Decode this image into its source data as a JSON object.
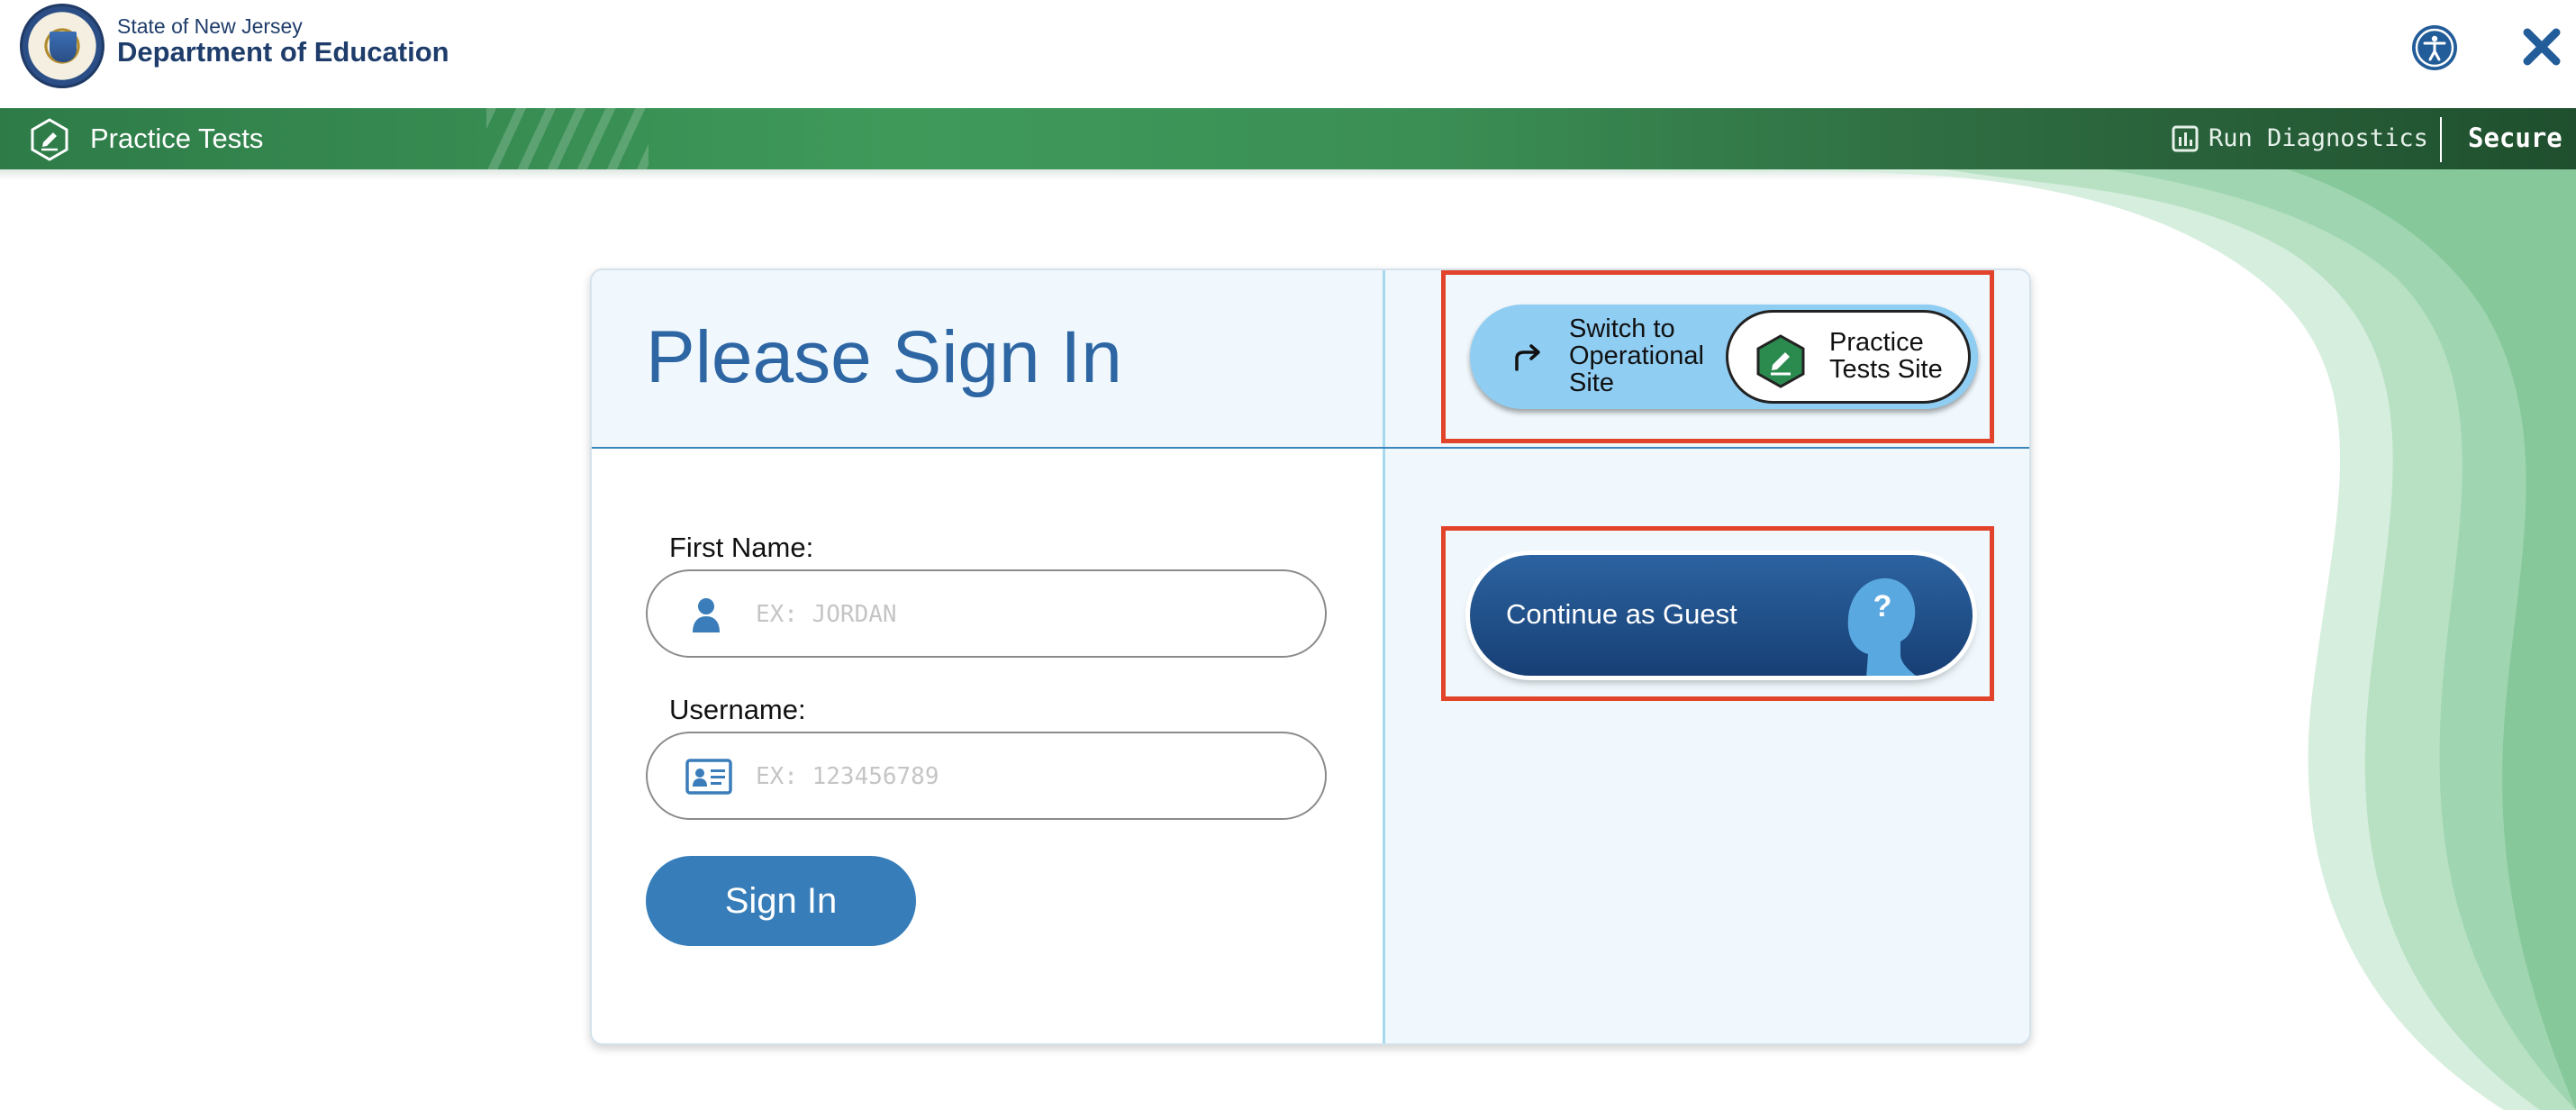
{
  "header": {
    "agency_sub": "State of New Jersey",
    "agency_main": "Department of Education",
    "icons": {
      "seal": "nj-state-seal-icon",
      "accessibility": "accessibility-icon",
      "close": "close-icon"
    }
  },
  "nav": {
    "title": "Practice Tests",
    "diagnostics_label": "Run Diagnostics",
    "secure_label": "Secure v",
    "icons": {
      "logo": "pencil-hexagon-icon",
      "diagnostics": "bar-chart-icon"
    }
  },
  "signin": {
    "title": "Please Sign In",
    "first_name_label": "First Name:",
    "first_name_placeholder": "EX: JORDAN",
    "first_name_value": "",
    "username_label": "Username:",
    "username_placeholder": "EX: 123456789",
    "username_value": "",
    "button_label": "Sign In",
    "icons": {
      "first_name": "person-icon",
      "username": "id-card-icon"
    }
  },
  "site_switch": {
    "switch_label": "Switch to Operational Site",
    "current_label": "Practice Tests Site",
    "icons": {
      "switch": "redirect-arrow-icon",
      "current": "pencil-hexagon-icon"
    }
  },
  "guest": {
    "label": "Continue as Guest",
    "icon": "guest-head-question-icon"
  },
  "colors": {
    "brand_blue": "#2d66a3",
    "nav_green": "#3f9a5a",
    "button_blue": "#367db9",
    "guest_blue": "#1f4f8a",
    "highlight_red": "#e2442b",
    "switch_blue": "#8fcdf3"
  }
}
